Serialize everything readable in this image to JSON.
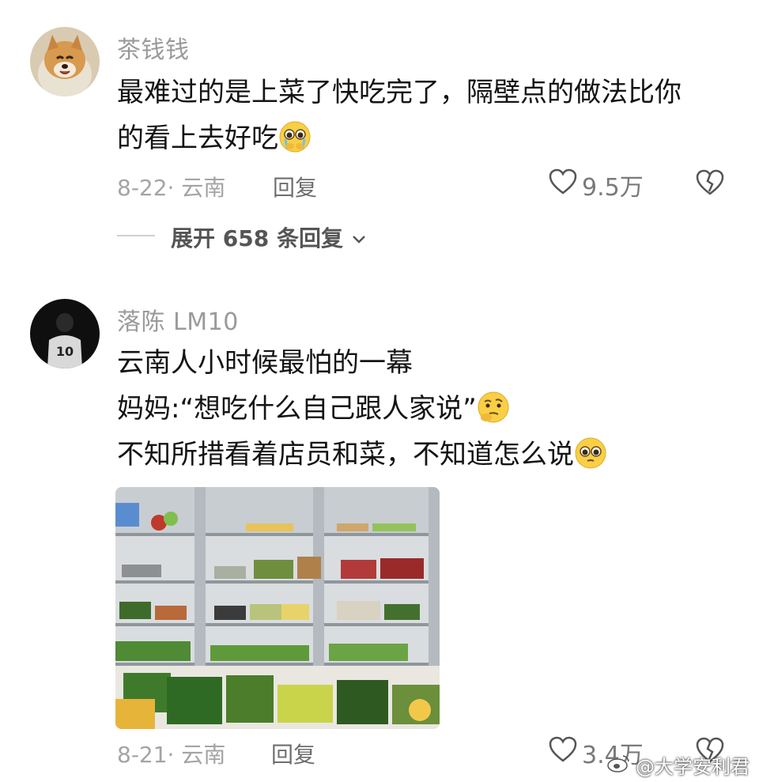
{
  "comments": [
    {
      "username": "茶钱钱",
      "lines": [
        "最难过的是上菜了快吃完了，隔壁点的做法比你",
        "的看上去好吃"
      ],
      "emoji": "crying-pleading-emoji",
      "date_location": "8-22· 云南",
      "reply_label": "回复",
      "likes": "9.5万",
      "expand_label": "展开 658 条回复"
    },
    {
      "username": "落陈 LM10",
      "lines": [
        "云南人小时候最怕的一幕",
        "妈妈:“想吃什么自己跟人家说”",
        "不知所措看着店员和菜，不知道怎么说"
      ],
      "emojis": [
        "thinking-emoji",
        "pleading-emoji"
      ],
      "date_location": "8-21· 云南",
      "reply_label": "回复",
      "likes": "3.4万",
      "photo_alt": "vegetable-display-fridge"
    }
  ],
  "watermark": "@大学安利君",
  "colors": {
    "muted": "#a4a4a4",
    "text": "#141414"
  }
}
